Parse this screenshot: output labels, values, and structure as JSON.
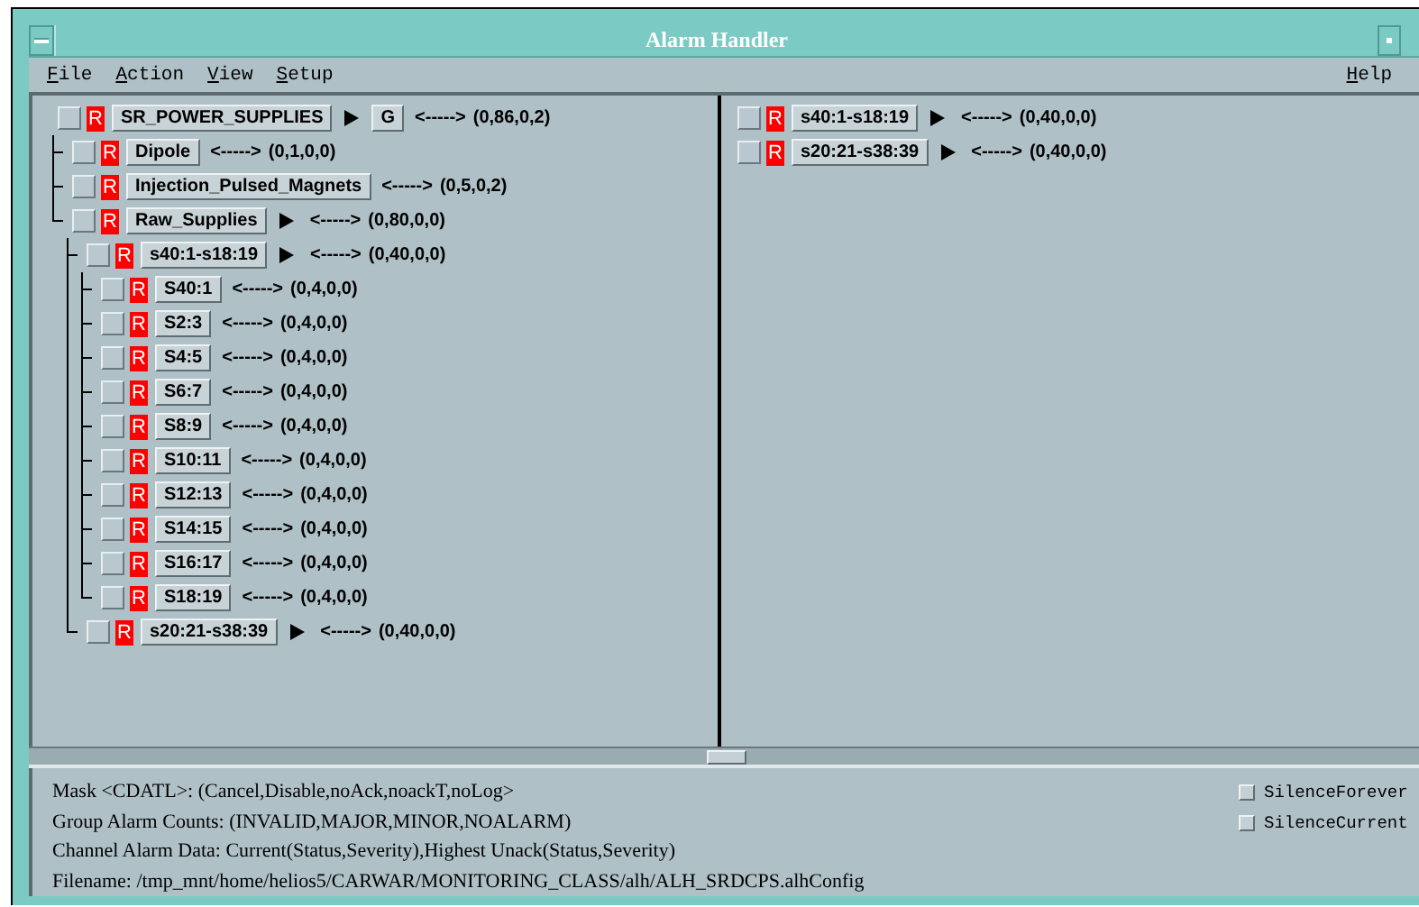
{
  "window": {
    "title": "Alarm Handler"
  },
  "menu": [
    {
      "label": "File"
    },
    {
      "label": "Action"
    },
    {
      "label": "View"
    },
    {
      "label": "Setup"
    }
  ],
  "help_menu": {
    "label": "Help"
  },
  "tree": [
    {
      "name": "SR_POWER_SUPPLIES",
      "severity": "R",
      "arrow": true,
      "guidance": "G",
      "link": "<----->",
      "counts": "(0,86,0,2)",
      "children": [
        {
          "name": "Dipole",
          "severity": "R",
          "arrow": false,
          "link": "<----->",
          "counts": "(0,1,0,0)"
        },
        {
          "name": "Injection_Pulsed_Magnets",
          "severity": "R",
          "arrow": false,
          "link": "<----->",
          "counts": "(0,5,0,2)"
        },
        {
          "name": "Raw_Supplies",
          "severity": "R",
          "arrow": true,
          "link": "<----->",
          "counts": "(0,80,0,0)",
          "children": [
            {
              "name": "s40:1-s18:19",
              "severity": "R",
              "arrow": true,
              "link": "<----->",
              "counts": "(0,40,0,0)",
              "children": [
                {
                  "name": "S40:1",
                  "severity": "R",
                  "arrow": false,
                  "link": "<----->",
                  "counts": "(0,4,0,0)"
                },
                {
                  "name": "S2:3",
                  "severity": "R",
                  "arrow": false,
                  "link": "<----->",
                  "counts": "(0,4,0,0)"
                },
                {
                  "name": "S4:5",
                  "severity": "R",
                  "arrow": false,
                  "link": "<----->",
                  "counts": "(0,4,0,0)"
                },
                {
                  "name": "S6:7",
                  "severity": "R",
                  "arrow": false,
                  "link": "<----->",
                  "counts": "(0,4,0,0)"
                },
                {
                  "name": "S8:9",
                  "severity": "R",
                  "arrow": false,
                  "link": "<----->",
                  "counts": "(0,4,0,0)"
                },
                {
                  "name": "S10:11",
                  "severity": "R",
                  "arrow": false,
                  "link": "<----->",
                  "counts": "(0,4,0,0)"
                },
                {
                  "name": "S12:13",
                  "severity": "R",
                  "arrow": false,
                  "link": "<----->",
                  "counts": "(0,4,0,0)"
                },
                {
                  "name": "S14:15",
                  "severity": "R",
                  "arrow": false,
                  "link": "<----->",
                  "counts": "(0,4,0,0)"
                },
                {
                  "name": "S16:17",
                  "severity": "R",
                  "arrow": false,
                  "link": "<----->",
                  "counts": "(0,4,0,0)"
                },
                {
                  "name": "S18:19",
                  "severity": "R",
                  "arrow": false,
                  "link": "<----->",
                  "counts": "(0,4,0,0)"
                }
              ]
            },
            {
              "name": "s20:21-s38:39",
              "severity": "R",
              "arrow": true,
              "link": "<----->",
              "counts": "(0,40,0,0)"
            }
          ]
        }
      ]
    }
  ],
  "group_list": [
    {
      "name": "s40:1-s18:19",
      "severity": "R",
      "arrow": true,
      "link": "<----->",
      "counts": "(0,40,0,0)"
    },
    {
      "name": "s20:21-s38:39",
      "severity": "R",
      "arrow": true,
      "link": "<----->",
      "counts": "(0,40,0,0)"
    }
  ],
  "status_lines": [
    "Mask <CDATL>: (Cancel,Disable,noAck,noackT,noLog>",
    "Group Alarm Counts: (INVALID,MAJOR,MINOR,NOALARM)",
    "Channel Alarm Data: Current(Status,Severity),Highest Unack(Status,Severity)",
    "Filename: /tmp_mnt/home/helios5/CARWAR/MONITORING_CLASS/alh/ALH_SRDCPS.alhConfig"
  ],
  "options": [
    {
      "label": "SilenceForever",
      "checked": false
    },
    {
      "label": "SilenceCurrent",
      "checked": false
    }
  ]
}
